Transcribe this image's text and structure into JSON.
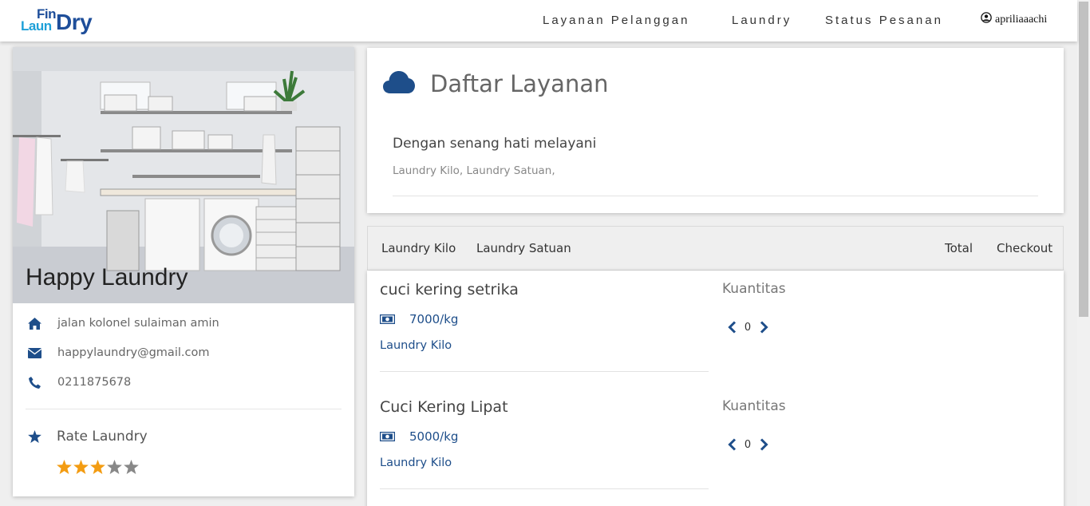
{
  "nav": {
    "logo": {
      "part1": "Fin",
      "part2": "Laun",
      "part3": "Dry"
    },
    "links": [
      "Layanan Pelanggan",
      "Laundry",
      "Status Pesanan"
    ],
    "user": "apriliaaachi"
  },
  "laundry": {
    "name": "Happy Laundry",
    "address": "jalan kolonel sulaiman amin",
    "email": "happylaundry@gmail.com",
    "phone": "0211875678",
    "rate_label": "Rate Laundry",
    "rating": 3,
    "rating_max": 5
  },
  "services_header": {
    "title": "Daftar Layanan",
    "subtitle": "Dengan senang hati melayani",
    "list": "Laundry Kilo, Laundry Satuan,"
  },
  "tabs": {
    "left": [
      "Laundry Kilo",
      "Laundry Satuan"
    ],
    "total": "Total",
    "checkout": "Checkout"
  },
  "services": [
    {
      "name": "cuci kering setrika",
      "price": "7000/kg",
      "category": "Laundry Kilo",
      "qty_label": "Kuantitas",
      "qty": "0"
    },
    {
      "name": "Cuci Kering Lipat",
      "price": "5000/kg",
      "category": "Laundry Kilo",
      "qty_label": "Kuantitas",
      "qty": "0"
    }
  ],
  "colors": {
    "primary": "#1e4e8a",
    "star_on": "#f39c12",
    "star_off": "#888888"
  }
}
